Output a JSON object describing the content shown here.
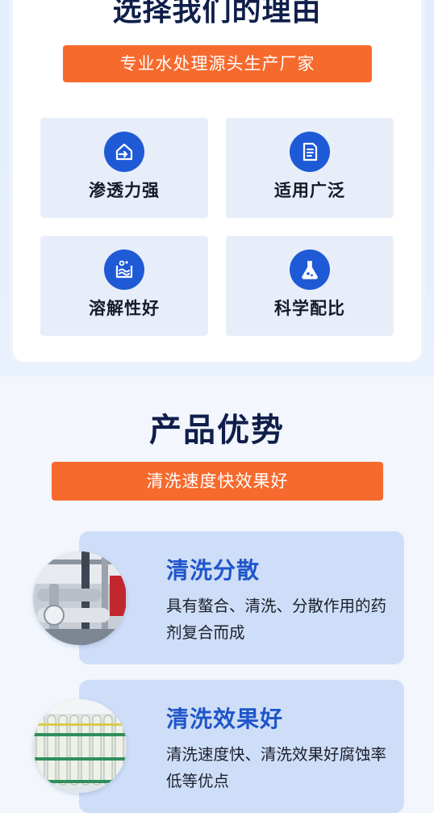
{
  "reasons": {
    "title": "选择我们的理由",
    "banner": "专业水处理源头生产厂家",
    "features": [
      {
        "label": "渗透力强",
        "icon": "house-arrow-icon"
      },
      {
        "label": "适用广泛",
        "icon": "document-icon"
      },
      {
        "label": "溶解性好",
        "icon": "dissolve-water-icon"
      },
      {
        "label": "科学配比",
        "icon": "flask-icon"
      }
    ]
  },
  "advantages": {
    "title": "产品优势",
    "banner": "清洗速度快效果好",
    "cards": [
      {
        "title": "清洗分散",
        "desc": "具有螯合、清洗、分散作用的药剂复合而成",
        "image": "industrial-pipes-photo"
      },
      {
        "title": "清洗效果好",
        "desc": "清洗速度快、清洗效果好腐蚀率低等优点",
        "image": "ro-membrane-rack-photo"
      }
    ]
  },
  "colors": {
    "accent_orange": "#f76a2d",
    "icon_blue": "#1f5ad6",
    "title_navy": "#0f1e4a",
    "card_blue": "#cfdef8",
    "card_title_blue": "#1f56c9"
  }
}
